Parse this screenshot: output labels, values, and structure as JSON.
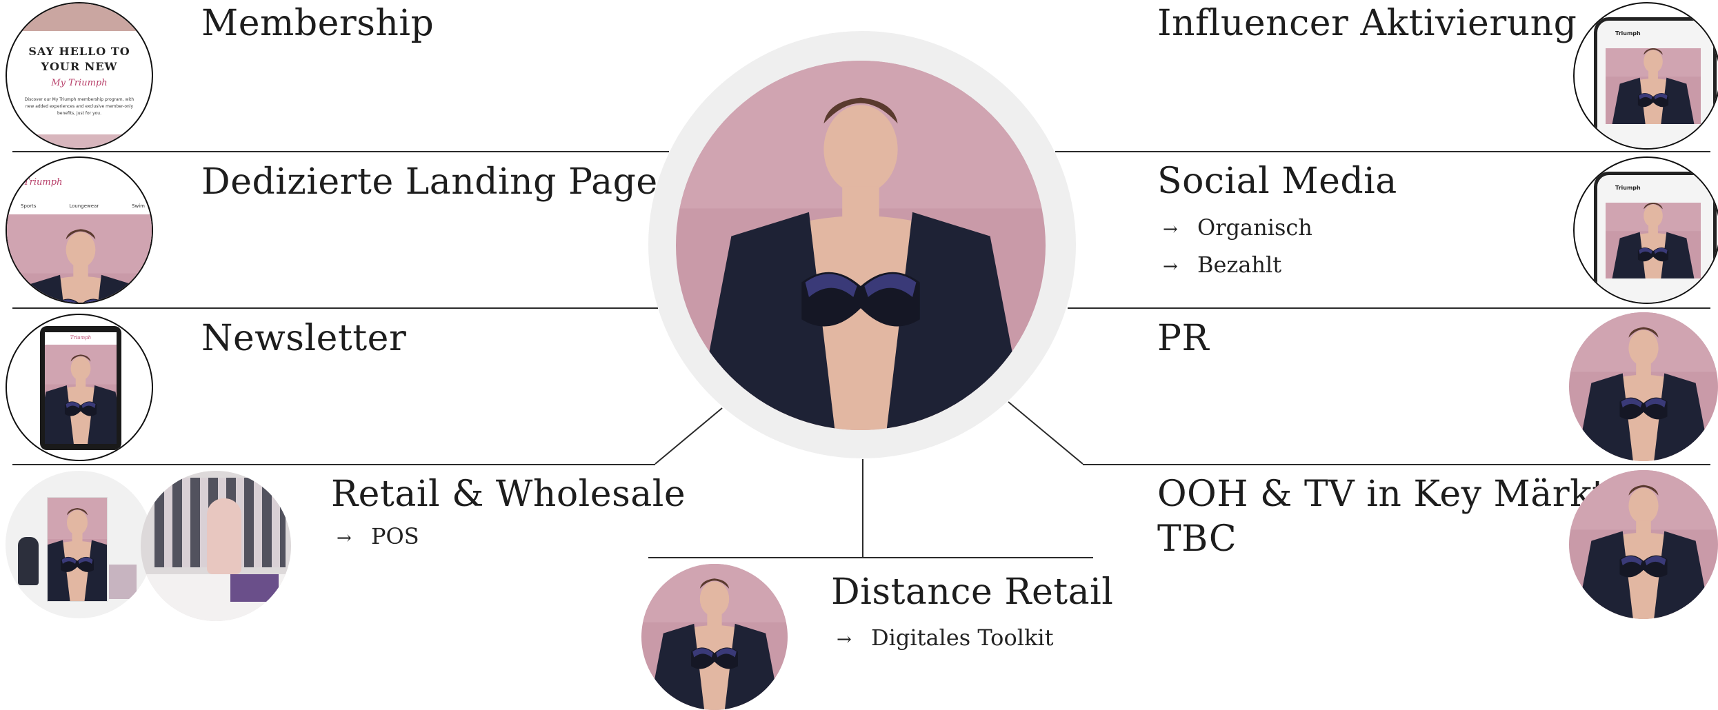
{
  "center": {
    "label": ""
  },
  "left": [
    {
      "title": "Membership",
      "subs": []
    },
    {
      "title": "Dedizierte Landing Page",
      "subs": []
    },
    {
      "title": "Newsletter",
      "subs": []
    },
    {
      "title": "Retail & Wholesale",
      "subs": [
        "POS"
      ]
    }
  ],
  "right": [
    {
      "title": "Influencer Aktivierung",
      "subs": []
    },
    {
      "title": "Social Media",
      "subs": [
        "Organisch",
        "Bezahlt"
      ]
    },
    {
      "title": "PR",
      "subs": []
    },
    {
      "title": "OOH & TV in Key Märkten",
      "title2": "TBC",
      "subs": []
    }
  ],
  "bottom": {
    "title": "Distance Retail",
    "subs": [
      "Digitales Toolkit"
    ]
  },
  "arrow": "→",
  "thumbs": {
    "membership_text1": "SAY HELLO TO",
    "membership_text2": "YOUR NEW",
    "membership_brand": "My Triumph",
    "membership_body1": "Discover our My Triumph membership program, with",
    "membership_body2": "new added experiences and exclusive member-only",
    "membership_body3": "benefits, just for you.",
    "landing_brand": "Triumph",
    "landing_nav": [
      "Sports",
      "Loungewear",
      "Swim"
    ],
    "social_brand": "Triumph",
    "tablet_brand": "Triumph"
  },
  "colors": {
    "backdrop": "#c99aa8",
    "jacket": "#1e2235",
    "lace": "#3a3a78",
    "skin": "#e2b7a2",
    "ring": "#efefef"
  }
}
